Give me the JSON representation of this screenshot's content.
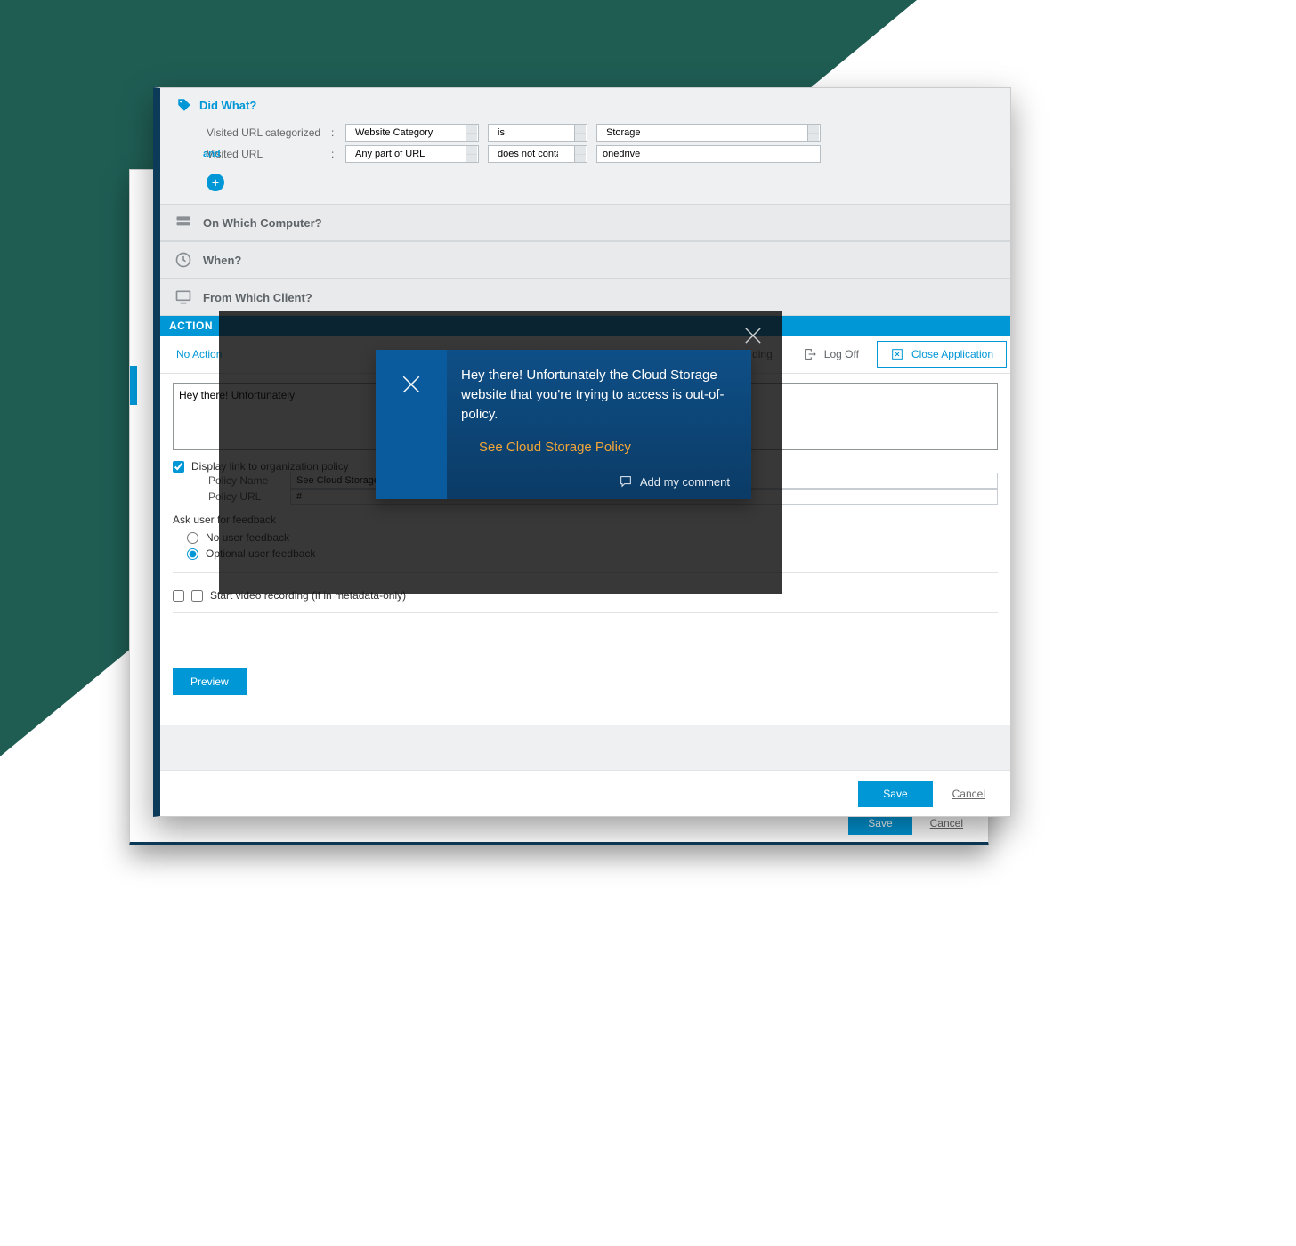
{
  "didwhat": {
    "title": "Did What?",
    "rule1_label": "Visited URL categorized",
    "rule1_sel1": "Website Category",
    "rule1_sel2": "is",
    "rule1_sel3": "Storage",
    "and_label": "and",
    "rule2_label": "Visited URL",
    "rule2_sel1": "Any part of URL",
    "rule2_sel2": "does not contain",
    "rule2_val": "onedrive"
  },
  "sections": {
    "computer": "On Which Computer?",
    "when": "When?",
    "client": "From Which Client?"
  },
  "action": {
    "header": "ACTION",
    "tabs": {
      "noaction": "No Action",
      "recording": "...ding",
      "logoff": "Log Off",
      "closeapp": "Close Application"
    },
    "message_text": "Hey there! Unfortunately",
    "display_link_label": "Display link to organization policy",
    "policy_name_label": "Policy Name",
    "policy_name_value": "See Cloud Storage Policy",
    "policy_url_label": "Policy URL",
    "policy_url_value": "#",
    "feedback_title": "Ask user for feedback",
    "feedback_none": "No user feedback",
    "feedback_optional": "Optional user feedback",
    "video_label": "Start video recording (if in metadata-only)",
    "preview": "Preview"
  },
  "footer": {
    "save": "Save",
    "cancel": "Cancel"
  },
  "popup": {
    "message": "Hey there! Unfortunately the Cloud Storage website that you're trying to access is out-of-policy.",
    "link": "See Cloud Storage Policy",
    "comment": "Add my comment"
  }
}
